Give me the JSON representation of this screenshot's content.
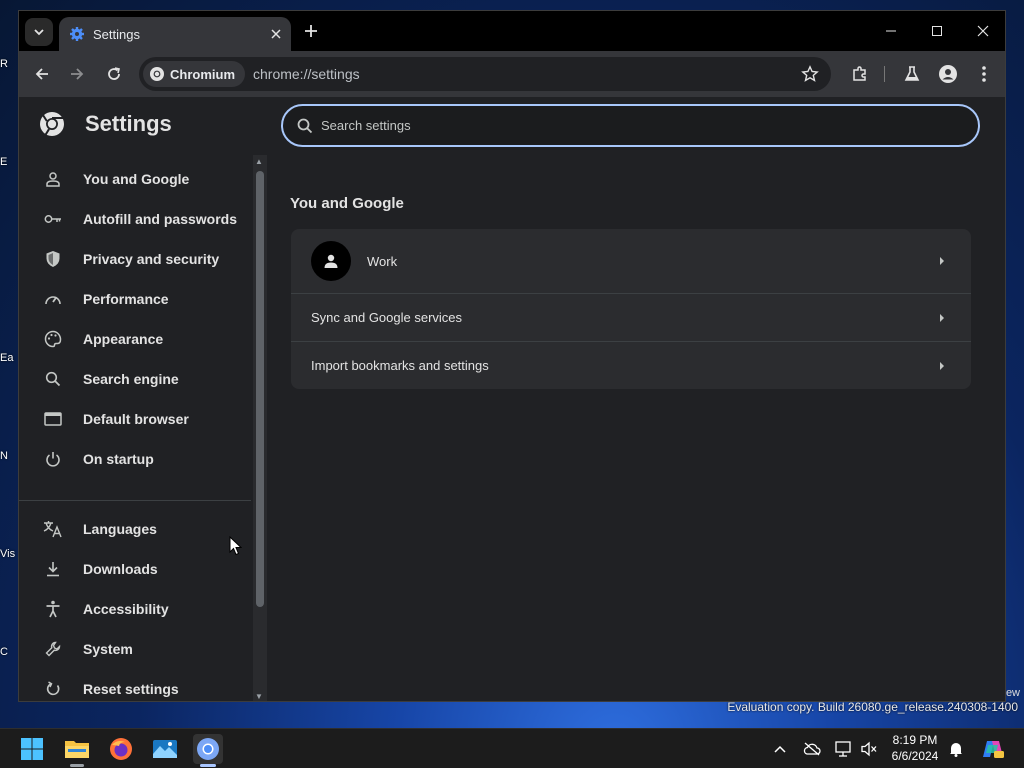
{
  "desktop": {
    "watermark": "Evaluation copy. Build 26080.ge_release.240308-1400",
    "watermark_edge": "ew",
    "icon_labels": [
      "R",
      "E",
      "Ea",
      "N",
      "Vis",
      "C"
    ]
  },
  "browser": {
    "tab": {
      "title": "Settings",
      "icon": "gear-icon"
    },
    "site_chip": "Chromium",
    "url": "chrome://settings"
  },
  "settings": {
    "title": "Settings",
    "search": {
      "placeholder": "Search settings",
      "value": ""
    },
    "nav": [
      {
        "label": "You and Google",
        "icon": "person-icon"
      },
      {
        "label": "Autofill and passwords",
        "icon": "key-icon"
      },
      {
        "label": "Privacy and security",
        "icon": "shield-icon"
      },
      {
        "label": "Performance",
        "icon": "gauge-icon"
      },
      {
        "label": "Appearance",
        "icon": "palette-icon"
      },
      {
        "label": "Search engine",
        "icon": "search-icon"
      },
      {
        "label": "Default browser",
        "icon": "browser-window-icon"
      },
      {
        "label": "On startup",
        "icon": "power-icon"
      },
      {
        "label": "Languages",
        "icon": "translate-icon"
      },
      {
        "label": "Downloads",
        "icon": "download-icon"
      },
      {
        "label": "Accessibility",
        "icon": "accessibility-icon"
      },
      {
        "label": "System",
        "icon": "wrench-icon"
      },
      {
        "label": "Reset settings",
        "icon": "reset-icon"
      }
    ],
    "section_title": "You and Google",
    "rows": [
      {
        "label": "Work"
      },
      {
        "label": "Sync and Google services"
      },
      {
        "label": "Import bookmarks and settings"
      }
    ]
  },
  "taskbar": {
    "time": "8:19 PM",
    "date": "6/6/2024"
  },
  "colors": {
    "accent": "#a8c7fa",
    "page_bg": "#202124",
    "card_bg": "#2b2c2f"
  }
}
